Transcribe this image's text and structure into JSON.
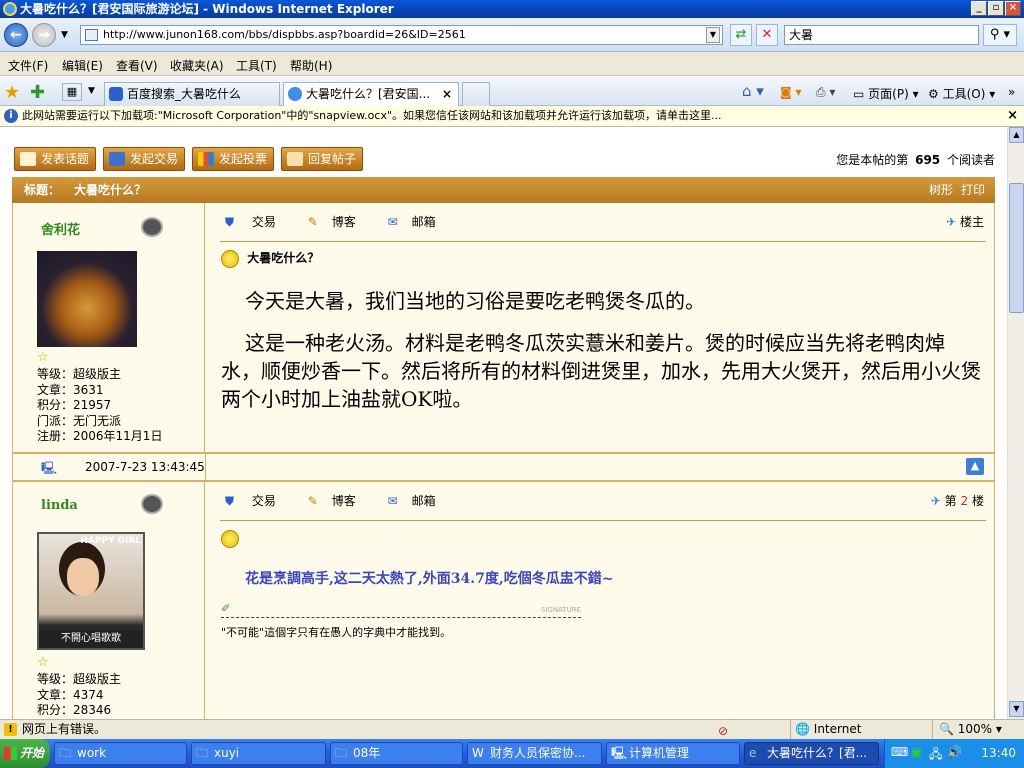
{
  "window": {
    "title": "大暑吃什么？[君安国际旅游论坛] - Windows Internet Explorer"
  },
  "address": {
    "url": "http://www.junon168.com/bbs/dispbbs.asp?boardid=26&ID=2561",
    "search": "大暑"
  },
  "menu": [
    "文件(F)",
    "编辑(E)",
    "查看(V)",
    "收藏夹(A)",
    "工具(T)",
    "帮助(H)"
  ],
  "tabs": [
    {
      "label": "百度搜索_大暑吃什么"
    },
    {
      "label": "大暑吃什么？[君安国..."
    }
  ],
  "toolbar": {
    "page": "页面(P)",
    "tools": "工具(O)"
  },
  "infobar": "此网站需要运行以下加载项:\"Microsoft Corporation\"中的\"snapview.ocx\"。如果您信任该网站和该加载项并允许运行该加载项，请单击这里...",
  "actions": {
    "new_topic": "发表话题",
    "new_trade": "发起交易",
    "new_poll": "发起投票",
    "reply": "回复帖子"
  },
  "readers": {
    "prefix": "您是本帖的第",
    "count": "695",
    "suffix": "个阅读者"
  },
  "thread": {
    "title_label": "标题：",
    "title": "大暑吃什么？",
    "tree": "树形",
    "print": "打印"
  },
  "post_tools": {
    "trade": "交易",
    "blog": "博客",
    "mail": "邮箱"
  },
  "post1": {
    "username": "舍利花",
    "floor": "楼主",
    "level": "等级：超级版主",
    "posts": "文章：3631",
    "points": "积分：21957",
    "sect": "门派：无门无派",
    "joined": "注册：2006年11月1日",
    "title": "大暑吃什么？",
    "p1": "今天是大暑，我们当地的习俗是要吃老鸭煲冬瓜的。",
    "p2": "这是一种老火汤。材料是老鸭冬瓜茨实薏米和姜片。煲的时候应当先将老鸭肉焯水，顺便炒香一下。然后将所有的材料倒进煲里，加水，先用大火煲开，然后用小火煲两个小时加上油盐就OK啦。",
    "time": "2007-7-23 13:43:45"
  },
  "post2": {
    "username": "linda",
    "floor_prefix": "第",
    "floor_num": "2",
    "floor_suffix": "楼",
    "avatar_text": "HAPPY GIRL",
    "avatar_caption": "不開心唱歌歌",
    "level": "等级：超级版主",
    "posts": "文章：4374",
    "points": "积分：28346",
    "body": "花是烹調高手,这二天太熱了,外面34.7度,吃個冬瓜盅不錯~",
    "sig_label": "SIGNATURE",
    "signature": "\"不可能\"這個字只有在愚人的字典中才能找到。"
  },
  "status": {
    "text": "网页上有错误。",
    "zone": "Internet",
    "zoom": "100%"
  },
  "taskbar": {
    "start": "开始",
    "items": [
      "work",
      "xuyi",
      "08年",
      "财务人员保密协...",
      "计算机管理",
      "大暑吃什么？[君..."
    ],
    "clock": "13:40"
  }
}
